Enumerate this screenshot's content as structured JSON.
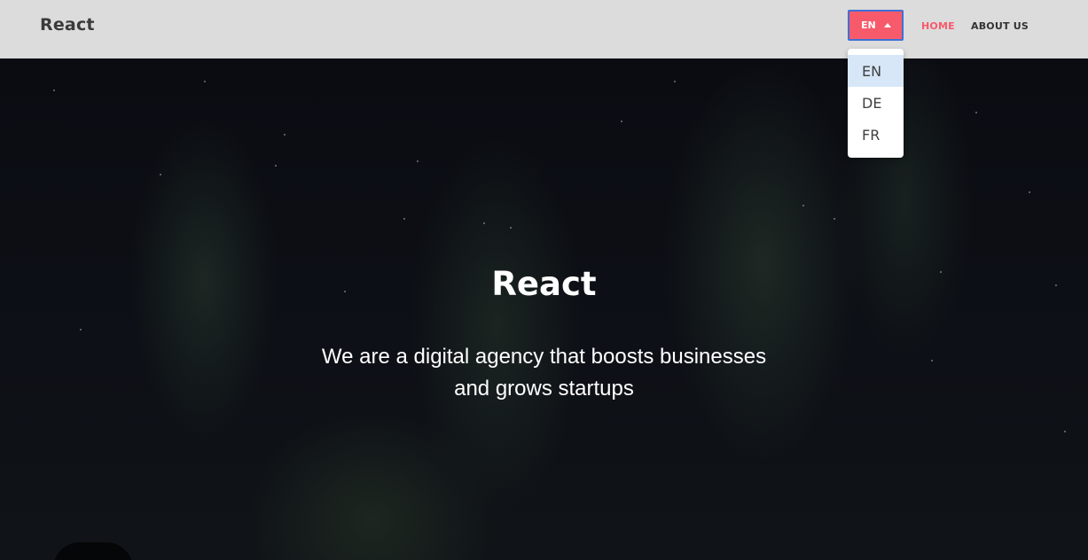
{
  "navbar": {
    "brand": "React",
    "language_toggle": {
      "label": "EN",
      "icon": "caret-up-icon"
    },
    "links": [
      {
        "label": "HOME",
        "active": true
      },
      {
        "label": "ABOUT US",
        "active": false
      }
    ]
  },
  "language_dropdown": {
    "items": [
      {
        "label": "EN",
        "selected": true
      },
      {
        "label": "DE",
        "selected": false
      },
      {
        "label": "FR",
        "selected": false
      }
    ]
  },
  "hero": {
    "title": "React",
    "subtitle_line1": "We are a digital agency that boosts businesses",
    "subtitle_line2": "and grows startups"
  },
  "colors": {
    "accent": "#f75a6b",
    "navbar_bg": "#dcdcdc",
    "dropdown_selected_bg": "#d7e7f7"
  }
}
